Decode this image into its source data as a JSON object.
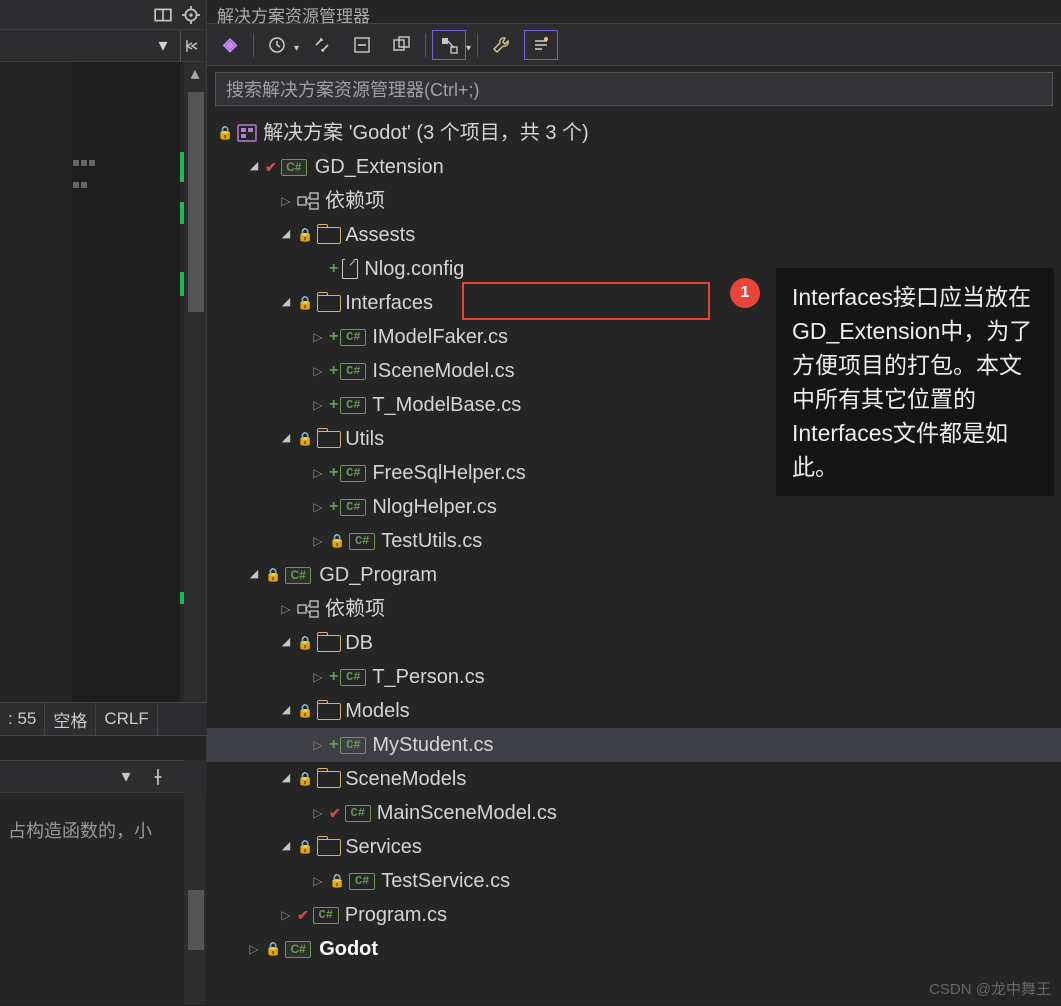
{
  "leftPane": {
    "scrollbar": true,
    "statusBar": {
      "col": ": 55",
      "spaces": "空格",
      "crlf": "CRLF"
    },
    "lowerPanel": {
      "text": "占构造函数的，小"
    }
  },
  "explorer": {
    "title": "解决方案资源管理器",
    "searchPlaceholder": "搜索解决方案资源管理器(Ctrl+;)",
    "toolbar": {
      "home": "⌂",
      "refresh": "↻",
      "sync": "⇆",
      "collapse": "⊟",
      "showall": "⧉",
      "preview": "◧",
      "dropdown": "▾",
      "wrench": "🔧",
      "props": "≡"
    },
    "solutionLabel": "解决方案 'Godot' (3 个项目，共 3 个)",
    "projects": {
      "gdExtension": {
        "name": "GD_Extension",
        "deps": "依赖项",
        "assets": {
          "name": "Assests",
          "nlog": "Nlog.config"
        },
        "interfaces": {
          "name": "Interfaces",
          "files": [
            "IModelFaker.cs",
            "ISceneModel.cs",
            "T_ModelBase.cs"
          ]
        },
        "utils": {
          "name": "Utils",
          "files": [
            "FreeSqlHelper.cs",
            "NlogHelper.cs",
            "TestUtils.cs"
          ]
        }
      },
      "gdProgram": {
        "name": "GD_Program",
        "deps": "依赖项",
        "db": {
          "name": "DB",
          "files": [
            "T_Person.cs"
          ]
        },
        "models": {
          "name": "Models",
          "files": [
            "MyStudent.cs"
          ]
        },
        "sceneModels": {
          "name": "SceneModels",
          "files": [
            "MainSceneModel.cs"
          ]
        },
        "services": {
          "name": "Services",
          "files": [
            "TestService.cs"
          ]
        },
        "program": "Program.cs"
      },
      "godot": {
        "name": "Godot"
      }
    }
  },
  "annotation": {
    "number": "1",
    "text": "Interfaces接口应当放在GD_Extension中，为了方便项目的打包。本文中所有其它位置的Interfaces文件都是如此。"
  },
  "watermark": "CSDN @龙中舞王"
}
